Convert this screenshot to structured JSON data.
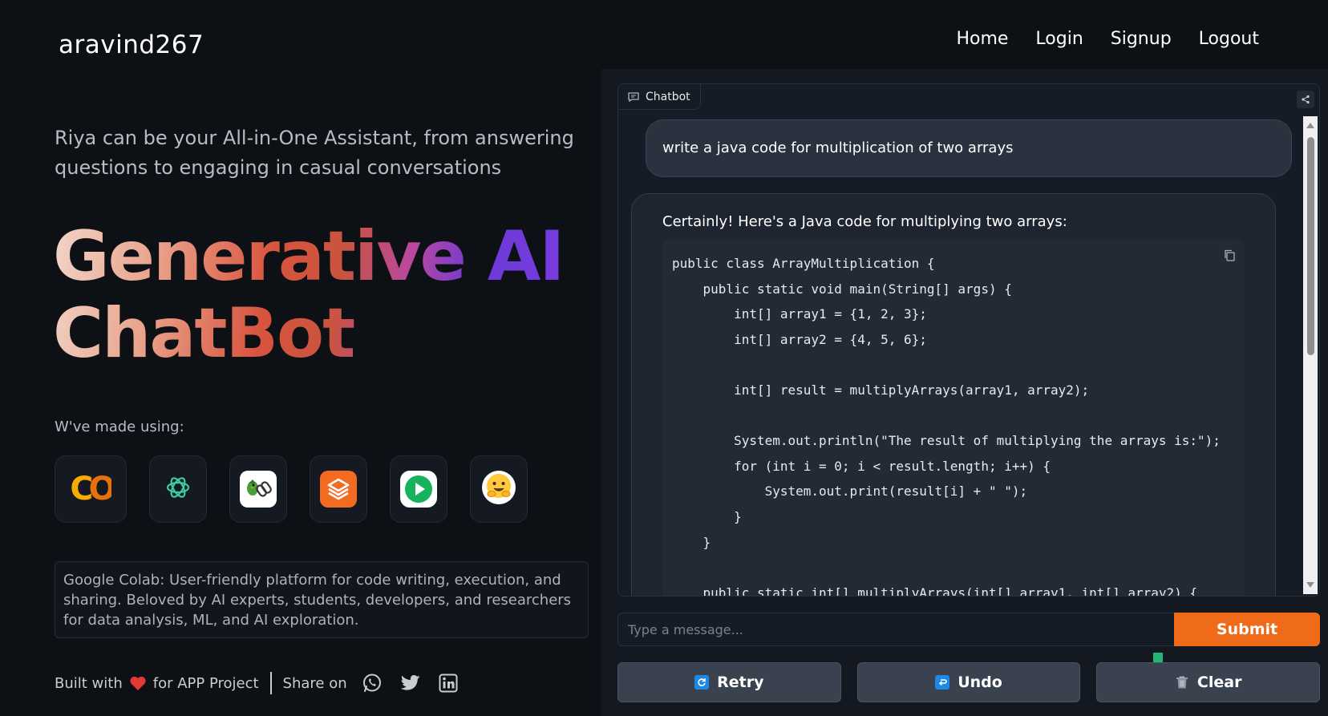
{
  "header": {
    "brand": "aravind267",
    "nav": [
      "Home",
      "Login",
      "Signup",
      "Logout"
    ]
  },
  "left": {
    "tagline": "Riya can be your All-in-One Assistant, from answering questions to engaging in casual conversations",
    "hero_line1": "Generative AI",
    "hero_line2": "ChatBot",
    "made_label": "W've made using:",
    "tools": [
      {
        "icon": "colab-icon",
        "glyph": "CO"
      },
      {
        "icon": "openai-icon"
      },
      {
        "icon": "langchain-icon"
      },
      {
        "icon": "stack-icon"
      },
      {
        "icon": "play-icon"
      },
      {
        "icon": "huggingface-icon"
      }
    ],
    "description": "Google Colab: User-friendly platform for code writing, execution, and sharing. Beloved by AI experts, students, developers, and researchers for data analysis, ML, and AI exploration.",
    "footer": {
      "built_with": "Built with",
      "for_project": "for APP Project",
      "share_on": "Share on"
    }
  },
  "chat": {
    "tab_label": "Chatbot",
    "user_message": "write a java code for multiplication of two arrays",
    "bot_intro": "Certainly! Here's a Java code for multiplying two arrays:",
    "code": "public class ArrayMultiplication {\n    public static void main(String[] args) {\n        int[] array1 = {1, 2, 3};\n        int[] array2 = {4, 5, 6};\n\n        int[] result = multiplyArrays(array1, array2);\n\n        System.out.println(\"The result of multiplying the arrays is:\");\n        for (int i = 0; i < result.length; i++) {\n            System.out.print(result[i] + \" \");\n        }\n    }\n\n    public static int[] multiplyArrays(int[] array1, int[] array2) {"
  },
  "input": {
    "placeholder": "Type a message...",
    "submit_label": "Submit"
  },
  "actions": {
    "retry": "Retry",
    "undo": "Undo",
    "clear": "Clear"
  },
  "colors": {
    "accent": "#ef6a19",
    "heart": "#e53935"
  }
}
